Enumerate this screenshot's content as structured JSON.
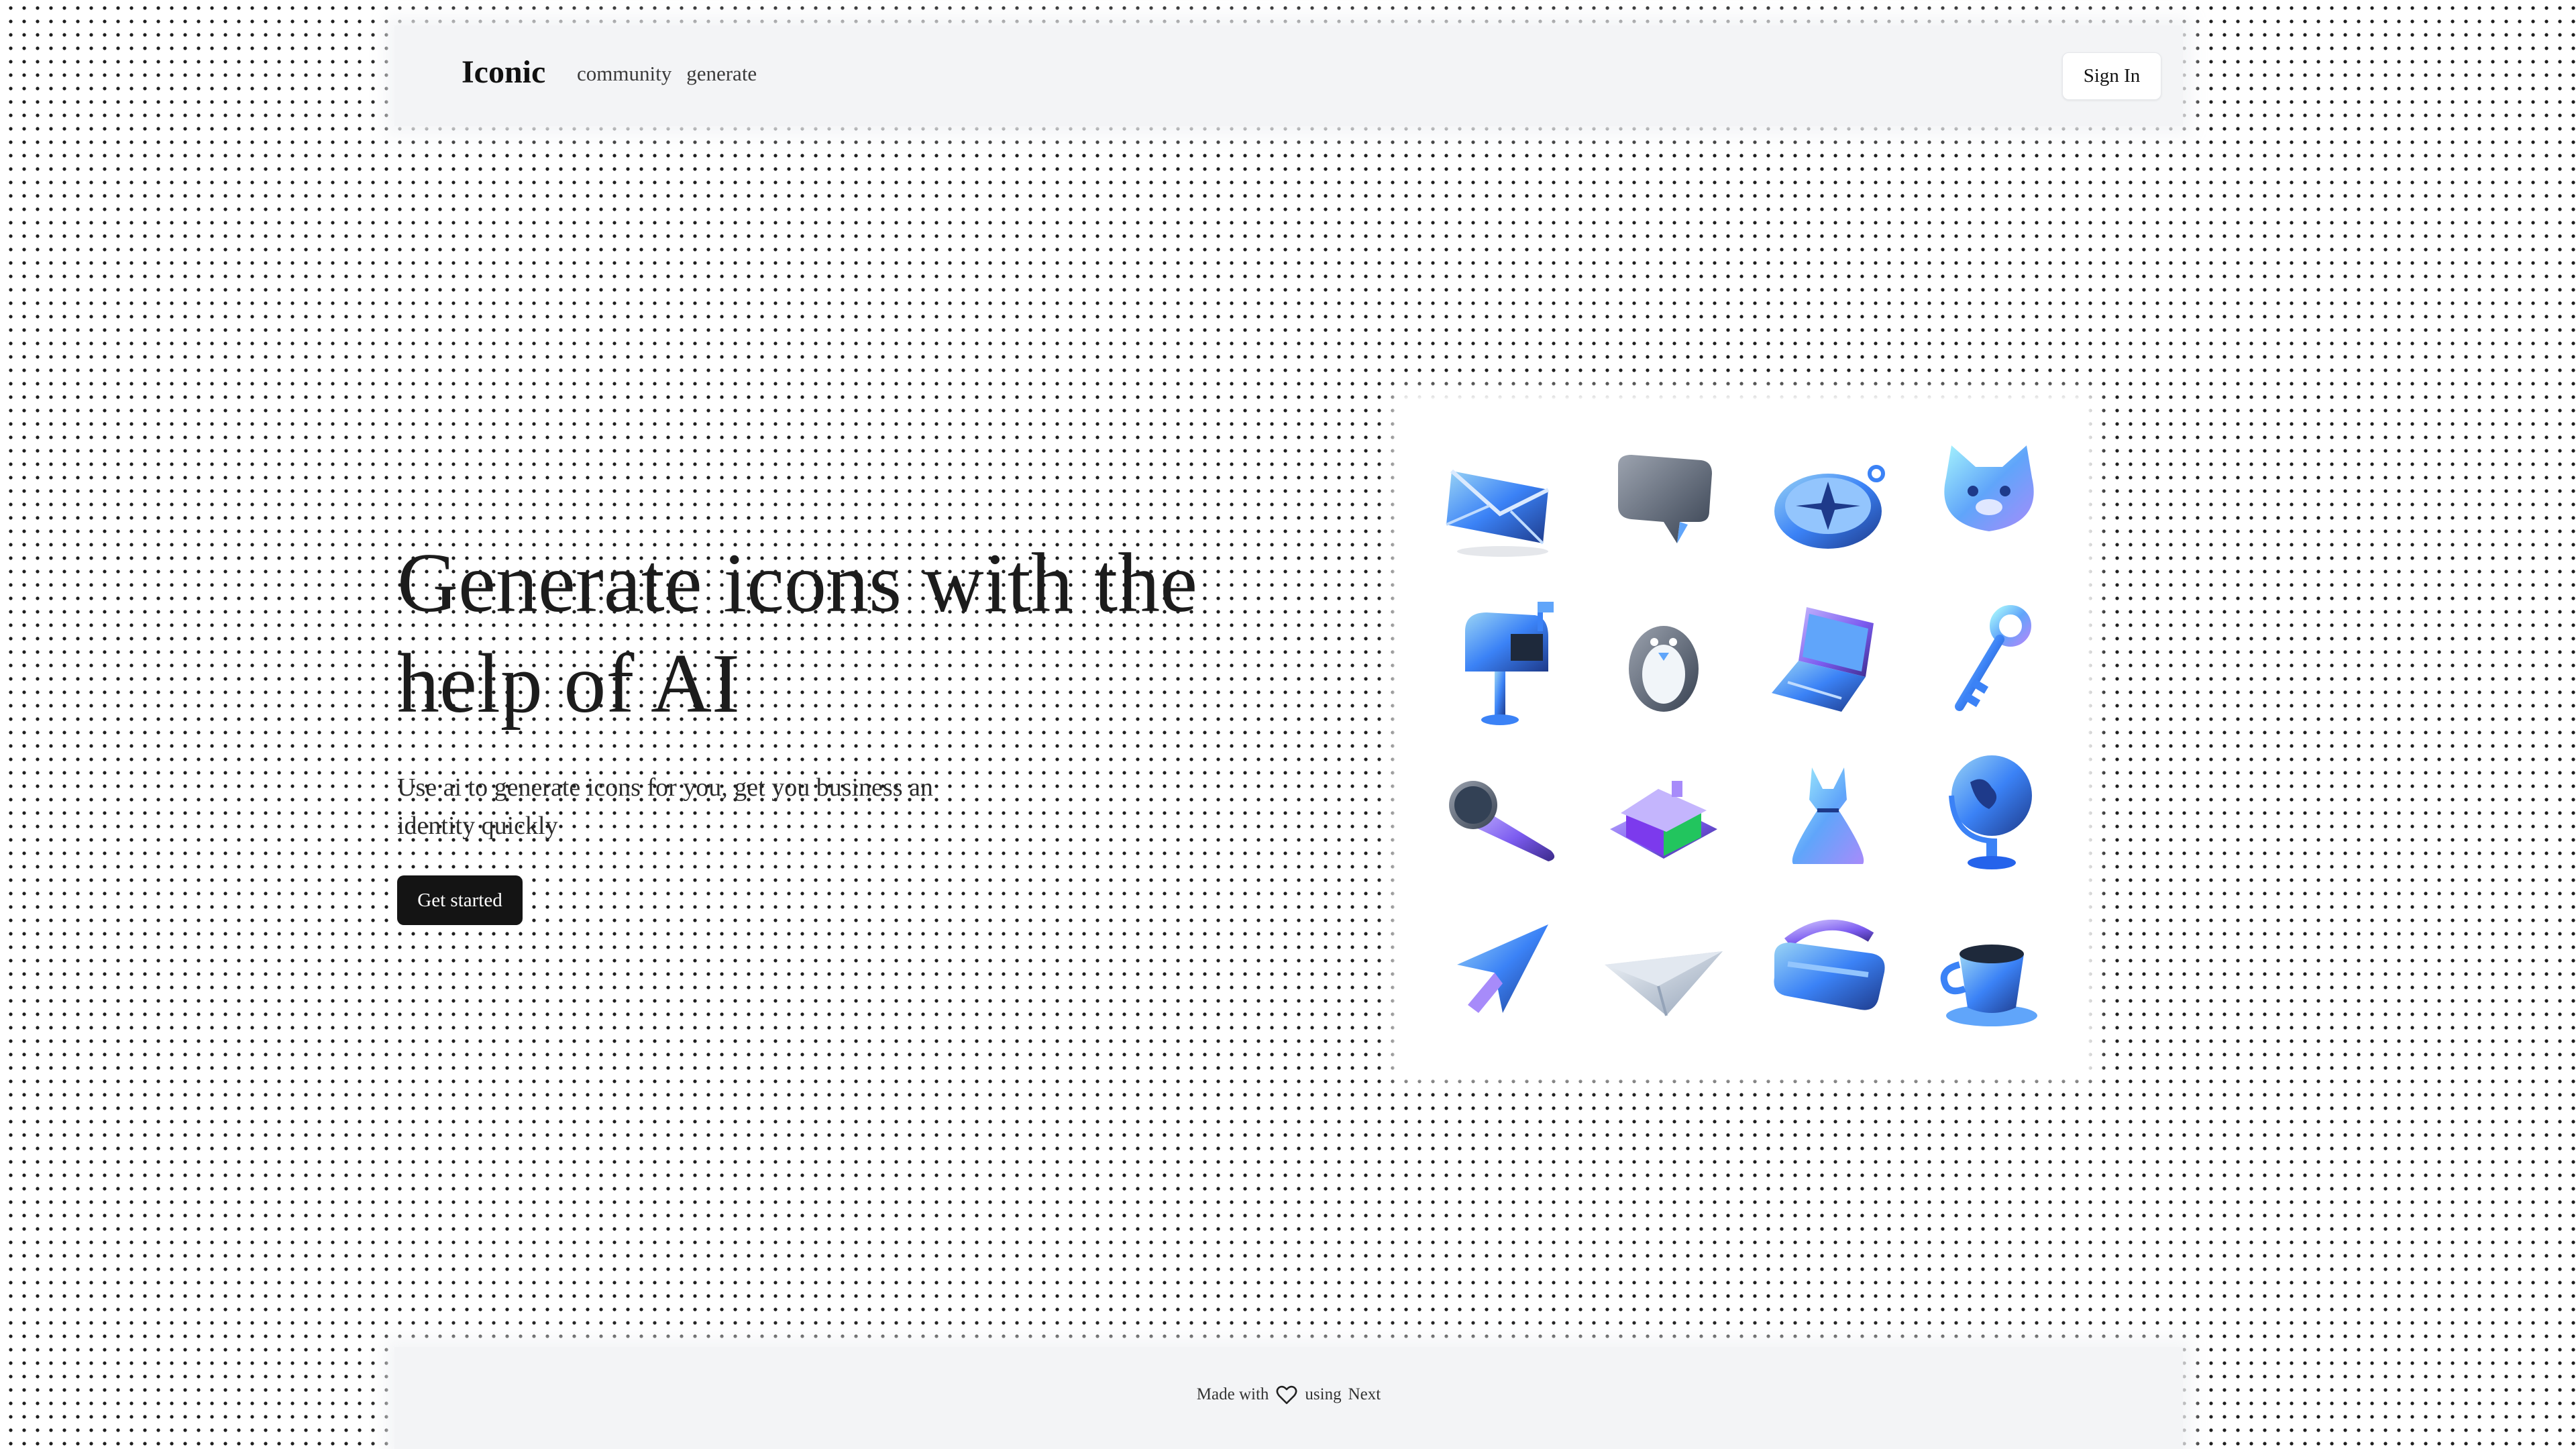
{
  "header": {
    "logo": "Iconic",
    "nav": [
      "community",
      "generate"
    ],
    "signin_label": "Sign In"
  },
  "hero": {
    "title_line1": "Generate icons with the",
    "title_line2": "help of AI",
    "subtitle": "Use ai to generate icons for you, get you business an identity quickly",
    "cta_label": "Get started"
  },
  "gallery": {
    "icons": [
      "envelope-icon",
      "speech-bubble-icon",
      "compass-icon",
      "cat-icon",
      "mailbox-icon",
      "penguin-icon",
      "laptop-icon",
      "key-icon",
      "microphone-icon",
      "house-icon",
      "dress-icon",
      "globe-icon",
      "cursor-icon",
      "paper-plane-icon",
      "vr-headset-icon",
      "teacup-icon"
    ]
  },
  "footer": {
    "made_with": "Made with",
    "using": "using",
    "tech": "Next"
  },
  "colors": {
    "accent_blue": "#3b82f6",
    "accent_purple": "#8b5cf6",
    "button_dark": "#141414"
  }
}
